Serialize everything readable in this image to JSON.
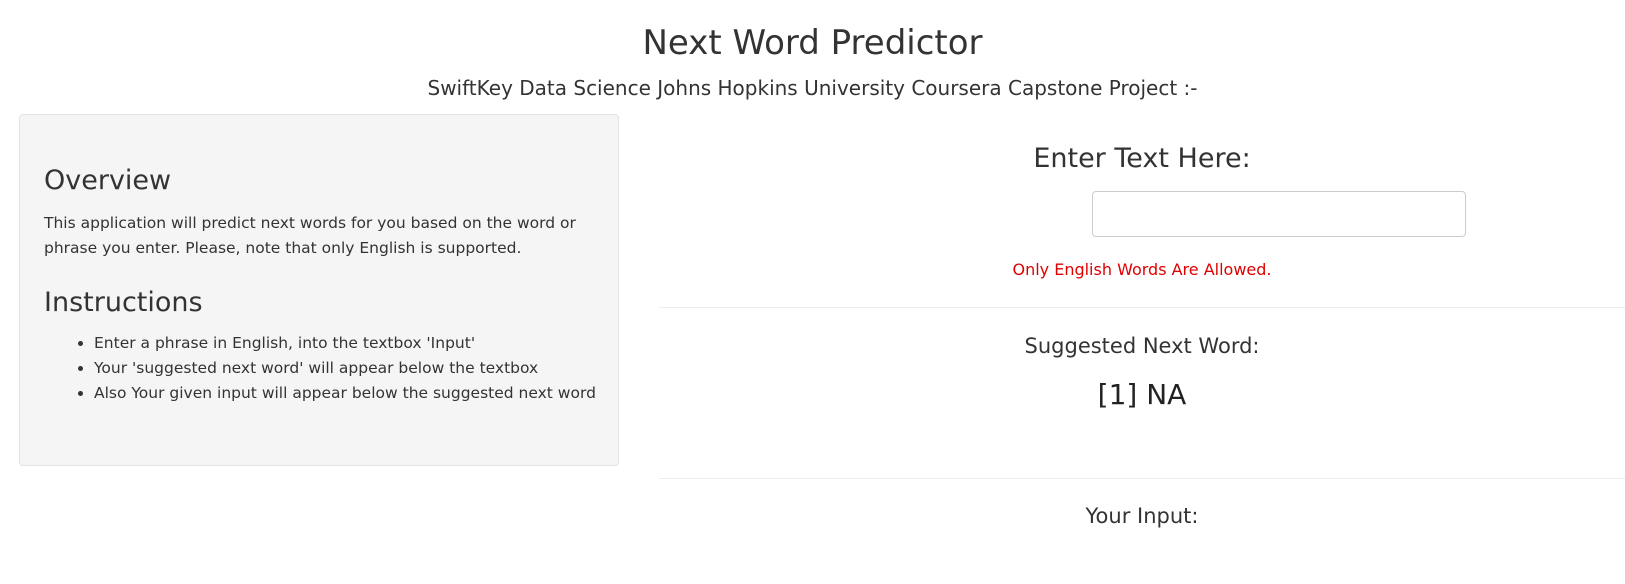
{
  "header": {
    "title": "Next Word Predictor",
    "subtitle": "SwiftKey Data Science Johns Hopkins University Coursera Capstone Project :-"
  },
  "sidebar": {
    "overview_heading": "Overview",
    "overview_text": "This application will predict next words for you based on the word or phrase you enter. Please, note that only English is supported.",
    "instructions_heading": "Instructions",
    "instructions": [
      "Enter a phrase in English, into the textbox 'Input'",
      "Your 'suggested next word' will appear below the textbox",
      "Also Your given input will appear below the suggested next word"
    ]
  },
  "main": {
    "input_label": "Enter Text Here:",
    "input_value": "",
    "warning": "Only English Words Are Allowed.",
    "suggested_label": "Suggested Next Word:",
    "suggested_value": "[1] NA",
    "your_input_label": "Your Input:"
  },
  "colors": {
    "warning": "#e00000",
    "sidebar_bg": "#f5f5f5"
  }
}
